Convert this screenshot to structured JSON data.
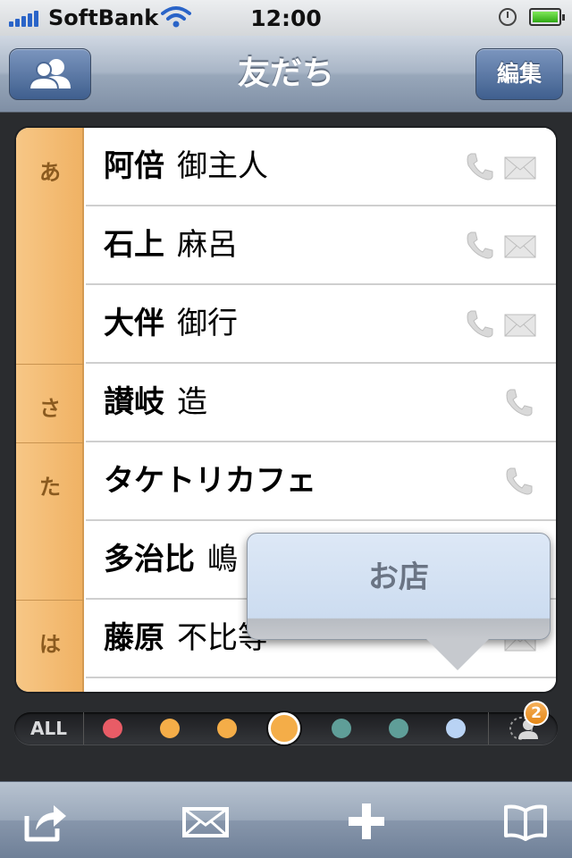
{
  "status_bar": {
    "carrier": "SoftBank",
    "time": "12:00",
    "battery_level": 1.0
  },
  "nav_bar": {
    "title": "友だち",
    "left_button_icon": "groups-icon",
    "right_button_label": "編集"
  },
  "index_letters": [
    "あ",
    "さ",
    "た",
    "は"
  ],
  "contacts": [
    {
      "family": "阿倍",
      "given": "御主人",
      "phone": true,
      "mail": true
    },
    {
      "family": "石上",
      "given": "麻呂",
      "phone": true,
      "mail": true
    },
    {
      "family": "大伴",
      "given": "御行",
      "phone": true,
      "mail": true
    },
    {
      "family": "讃岐",
      "given": "造",
      "phone": true,
      "mail": false
    },
    {
      "family": "タケトリカフェ",
      "given": "",
      "phone": true,
      "mail": false
    },
    {
      "family": "多治比",
      "given": "嶋",
      "phone": false,
      "mail": false
    },
    {
      "family": "藤原",
      "given": "不比等",
      "phone": false,
      "mail": true
    }
  ],
  "popover": {
    "label": "お店"
  },
  "filter_bar": {
    "all_label": "ALL",
    "colors": [
      "#e85c66",
      "#f4ad48",
      "#f4ad48",
      "#f4ad48",
      "#5f9e98",
      "#5f9e98",
      "#b9d3f4"
    ],
    "selected_index": 3,
    "badge_count": "2"
  },
  "toolbar": {
    "icons": [
      "share-icon",
      "mail-icon",
      "add-icon",
      "bookmarks-icon"
    ]
  }
}
